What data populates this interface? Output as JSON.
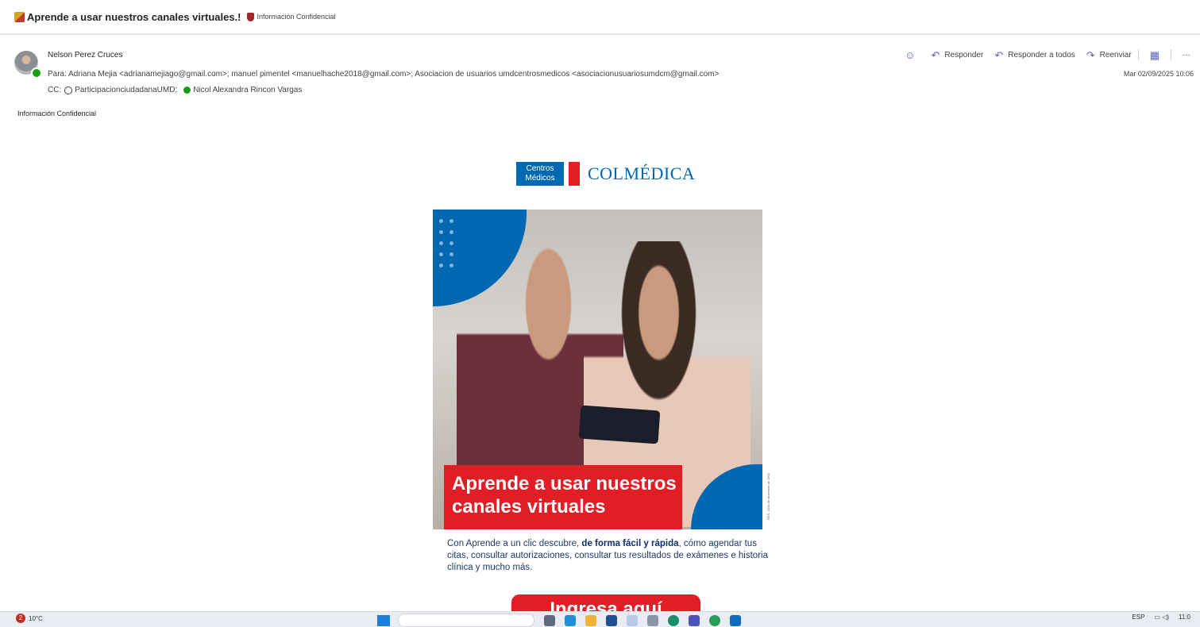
{
  "email": {
    "subject": "Aprende a usar nuestros canales virtuales.!",
    "sensitivity_label": "Información Confidencial",
    "sender": "Nelson Perez Cruces",
    "to_line": "Para:  Adriana Mejia <adrianamejiago@gmail.com>;  manuel pimentel <manuelhache2018@gmail.com>;  Asociacion de usuarios umdcentrosmedicos <asociacionusuariosumdcm@gmail.com>",
    "cc_prefix": "CC:",
    "cc_group": "ParticipacionciudadanaUMD;",
    "cc_person": "Nicol Alexandra Rincon Vargas",
    "date": "Mar 02/09/2025 10:06",
    "body_sensitivity_note": "Información Confidencial"
  },
  "actions": {
    "reply": "Responder",
    "reply_all": "Responder a todos",
    "forward": "Reenviar",
    "more": "···"
  },
  "banner": {
    "logo_box_line1": "Centros",
    "logo_box_line2": "Médicos",
    "logo_text": "COLMÉDICA",
    "headline_line1": "Aprende a usar nuestros",
    "headline_line2": "canales virtuales",
    "res_label": "RES. 2044 de diciembre de 1992",
    "desc_1": "Con Aprende a un clic descubre, ",
    "desc_bold": "de forma fácil y rápida",
    "desc_2": ", cómo agendar tus citas, consultar autorizaciones, consultar tus resultados de exámenes e historia clínica y mucho más.",
    "cta": "Ingresa aquí"
  },
  "taskbar": {
    "weather_badge": "2",
    "temperature": "10°C",
    "language": "ESP",
    "time": "11:0"
  },
  "colors": {
    "brand_blue": "#0067b1",
    "brand_red": "#e11e26",
    "outlook_accent": "#5b5fc7"
  }
}
